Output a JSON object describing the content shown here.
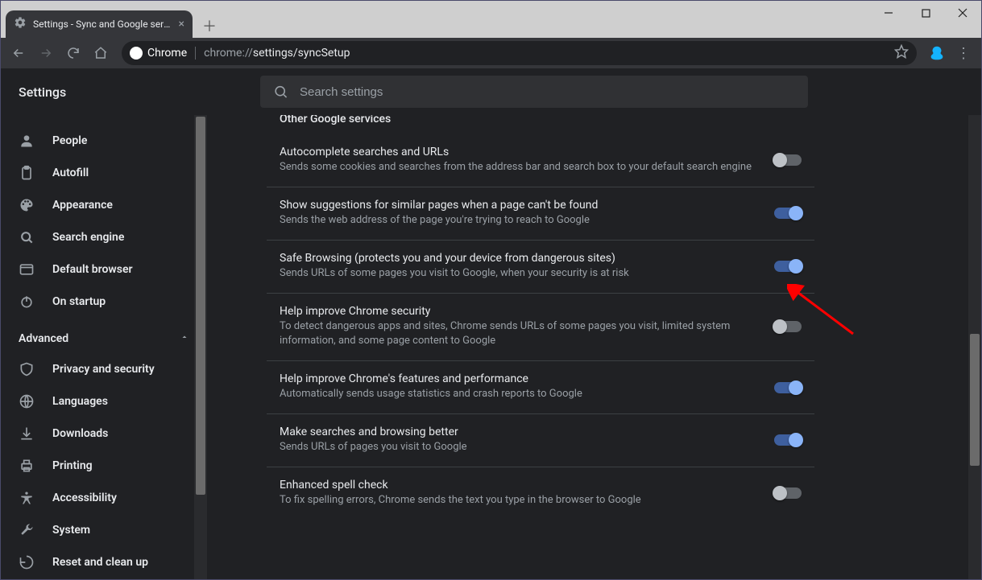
{
  "window": {
    "tab_title": "Settings - Sync and Google servic",
    "new_tab_tooltip": "New tab"
  },
  "omnibox": {
    "chip_label": "Chrome",
    "url_prefix": "chrome://",
    "url_path": "settings/syncSetup"
  },
  "app": {
    "title": "Settings",
    "search_placeholder": "Search settings"
  },
  "sidebar": {
    "advanced_label": "Advanced",
    "items": [
      {
        "icon": "person",
        "label": "People"
      },
      {
        "icon": "clipboard",
        "label": "Autofill"
      },
      {
        "icon": "palette",
        "label": "Appearance"
      },
      {
        "icon": "search",
        "label": "Search engine"
      },
      {
        "icon": "browser",
        "label": "Default browser"
      },
      {
        "icon": "power",
        "label": "On startup"
      }
    ],
    "advanced_items": [
      {
        "icon": "shield",
        "label": "Privacy and security"
      },
      {
        "icon": "globe",
        "label": "Languages"
      },
      {
        "icon": "download",
        "label": "Downloads"
      },
      {
        "icon": "printer",
        "label": "Printing"
      },
      {
        "icon": "accessibility",
        "label": "Accessibility"
      },
      {
        "icon": "wrench",
        "label": "System"
      },
      {
        "icon": "restore",
        "label": "Reset and clean up"
      }
    ]
  },
  "section": {
    "title": "Other Google services",
    "rows": [
      {
        "title": "Autocomplete searches and URLs",
        "sub": "Sends some cookies and searches from the address bar and search box to your default search engine",
        "on": false
      },
      {
        "title": "Show suggestions for similar pages when a page can't be found",
        "sub": "Sends the web address of the page you're trying to reach to Google",
        "on": true
      },
      {
        "title": "Safe Browsing (protects you and your device from dangerous sites)",
        "sub": "Sends URLs of some pages you visit to Google, when your security is at risk",
        "on": true
      },
      {
        "title": "Help improve Chrome security",
        "sub": "To detect dangerous apps and sites, Chrome sends URLs of some pages you visit, limited system information, and some page content to Google",
        "on": false
      },
      {
        "title": "Help improve Chrome's features and performance",
        "sub": "Automatically sends usage statistics and crash reports to Google",
        "on": true
      },
      {
        "title": "Make searches and browsing better",
        "sub": "Sends URLs of pages you visit to Google",
        "on": true
      },
      {
        "title": "Enhanced spell check",
        "sub": "To fix spelling errors, Chrome sends the text you type in the browser to Google",
        "on": false
      }
    ]
  }
}
